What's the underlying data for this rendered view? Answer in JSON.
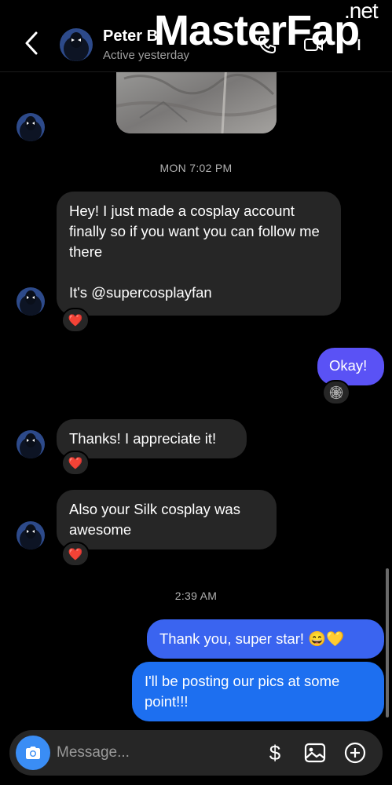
{
  "header": {
    "contact_name": "Peter B",
    "status": "Active yesterday",
    "watermark_main": "MasterFap",
    "watermark_suffix": ".net"
  },
  "messages": {
    "timestamp_1": "MON 7:02 PM",
    "incoming_1": "Hey! I just made a cosplay account finally so if you want you can follow me there\n\nIt's @supercosplayfan",
    "reaction_1": "❤️",
    "outgoing_1": "Okay!",
    "reaction_2": "🕸",
    "incoming_2": "Thanks! I appreciate it!",
    "reaction_3": "❤️",
    "incoming_3": "Also your Silk cosplay was awesome",
    "reaction_4": "❤️",
    "timestamp_2": "2:39 AM",
    "outgoing_2": "Thank you, super star! 😄💛",
    "outgoing_3": "I'll be posting our pics at some point!!!"
  },
  "composer": {
    "placeholder": "Message...",
    "money_symbol": "$"
  },
  "colors": {
    "background": "#000000",
    "incoming_bubble": "#262626",
    "outgoing_purple": "#5a52f5",
    "outgoing_blue": "#1d6ff0",
    "camera_button": "#3a8df5"
  }
}
